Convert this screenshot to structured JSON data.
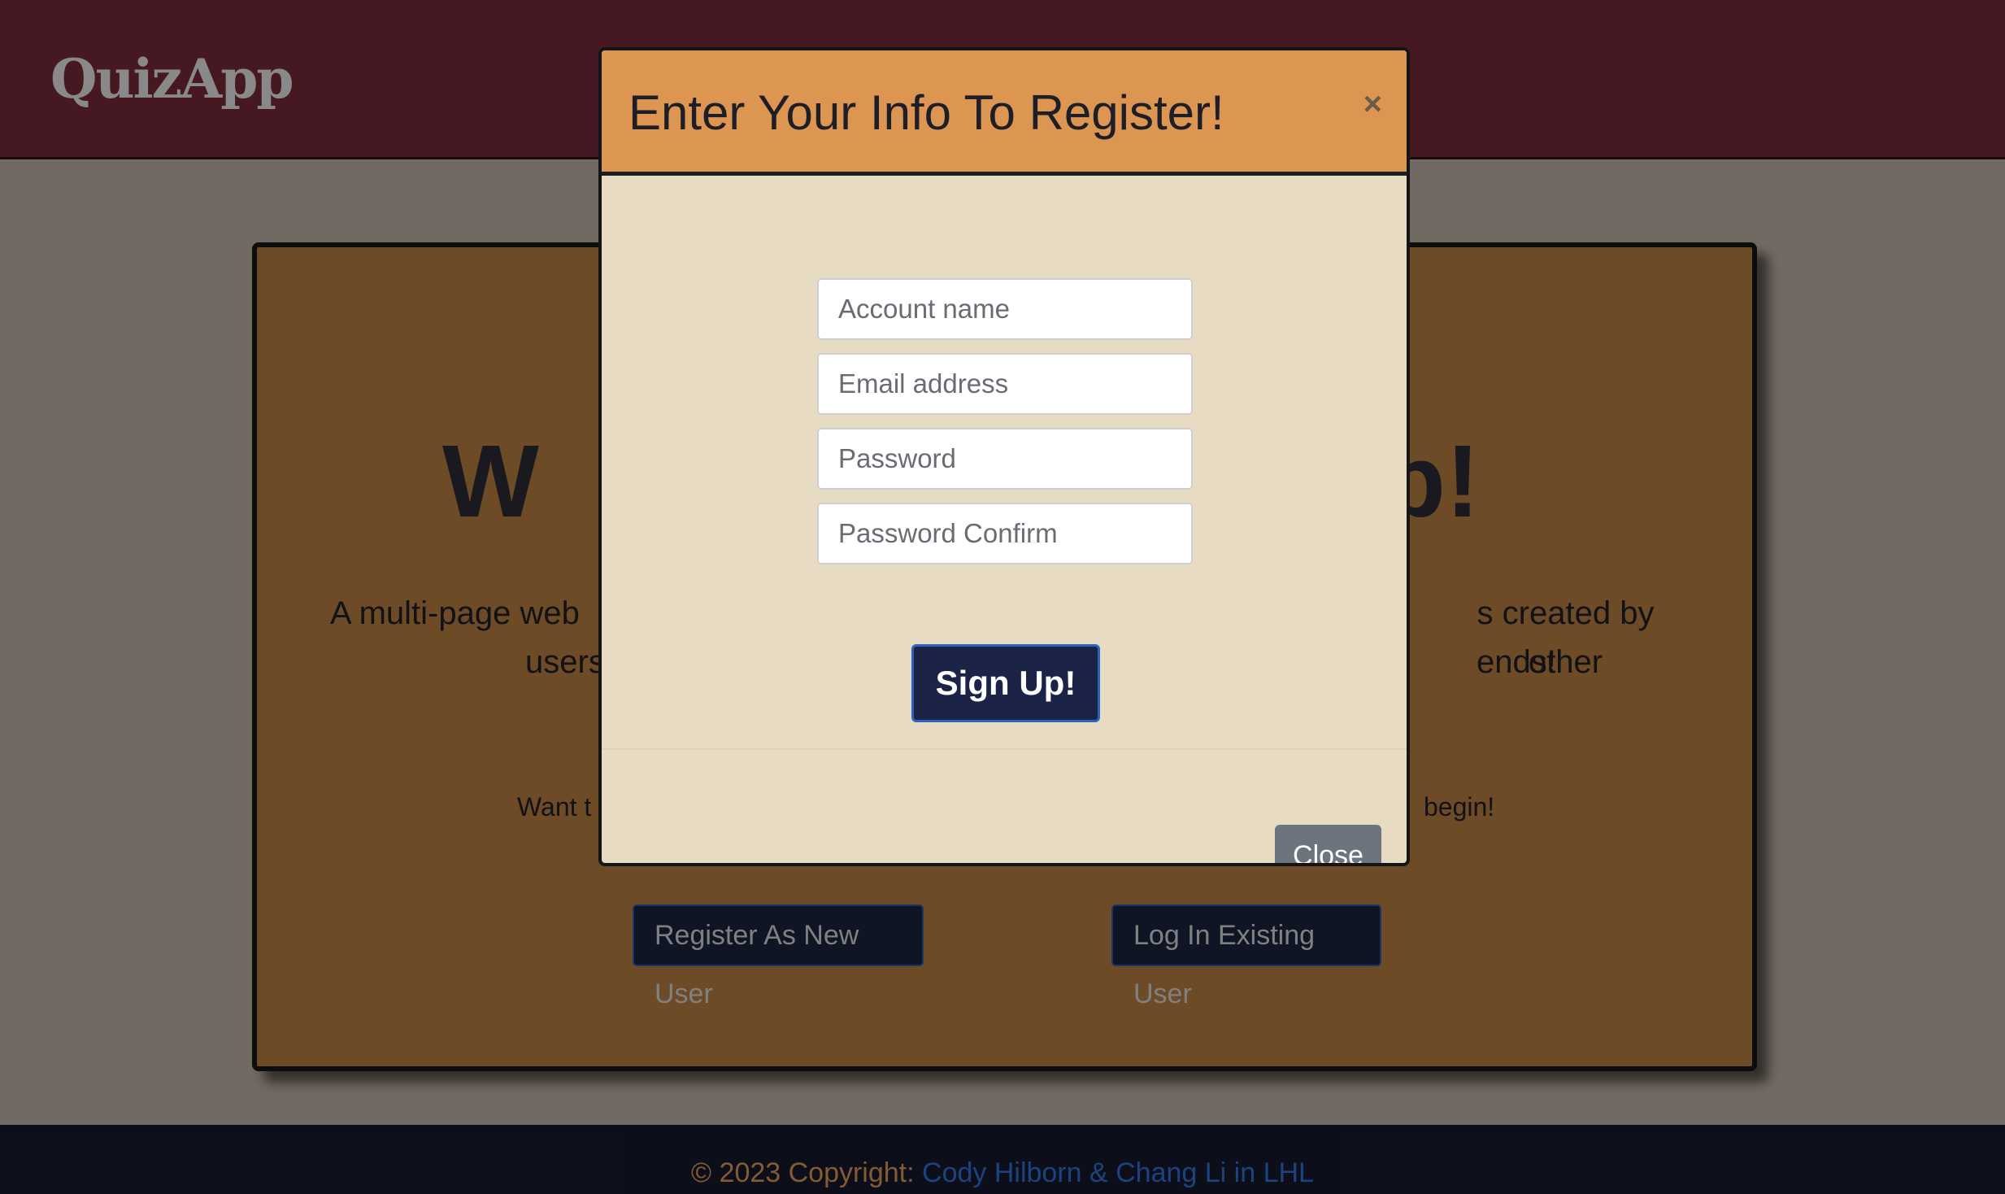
{
  "header": {
    "brand": "QuizApp"
  },
  "hero": {
    "title_start": "W",
    "title_end": "p!",
    "text_left_line1": "A multi-page web",
    "text_right_line1": "s created by other",
    "text_left_line2": "users",
    "text_right_line2": "ends!",
    "cta_left": "Want t",
    "cta_right": "begin!"
  },
  "buttons": {
    "register": "Register As New User",
    "login": "Log In Existing User"
  },
  "modal": {
    "title": "Enter Your Info To Register!",
    "close_x": "×",
    "fields": {
      "account_placeholder": "Account name",
      "email_placeholder": "Email address",
      "password_placeholder": "Password",
      "password_confirm_placeholder": "Password Confirm"
    },
    "signup_label": "Sign Up!",
    "close_label": "Close"
  },
  "footer": {
    "prefix": "© 2023 Copyright: ",
    "link_text": "Cody Hilborn & Chang Li in LHL"
  },
  "colors": {
    "navbar": "#76293a",
    "card": "#b57d40",
    "modal_header": "#dd9652",
    "modal_body": "#e8dbc4",
    "button_dark": "#1c2440",
    "footer": "#141a2b"
  }
}
